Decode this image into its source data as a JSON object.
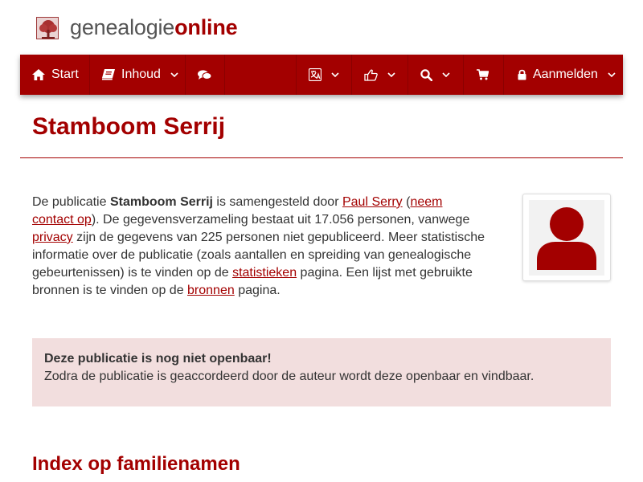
{
  "brand": {
    "name_plain": "genealogie",
    "name_accent": "online"
  },
  "nav": {
    "start": "Start",
    "inhoud": "Inhoud",
    "aanmelden": "Aanmelden"
  },
  "page": {
    "title": "Stamboom Serrij"
  },
  "intro": {
    "t1": "De publicatie ",
    "pub_name": "Stamboom Serrij",
    "t2": " is samengesteld door ",
    "author_link": "Paul Serry",
    "t3": " (",
    "contact_link": "neem contact op",
    "t4": "). De gegevensverzameling bestaat uit 17.056 personen, vanwege ",
    "privacy_link": "privacy",
    "t5": " zijn de gegevens van 225 personen niet gepubliceerd. Meer statistische informatie over de publicatie (zoals aantallen en spreiding van genealogische gebeurtenissen) is te vinden op de ",
    "stats_link": "statistieken",
    "t6": " pagina. Een lijst met gebruikte bronnen is te vinden op de ",
    "sources_link": "bronnen",
    "t7": " pagina."
  },
  "alert": {
    "title": "Deze publicatie is nog niet openbaar!",
    "text": "Zodra de publicatie is geaccordeerd door de auteur wordt deze openbaar en vindbaar."
  },
  "index": {
    "title": "Index op familienamen"
  },
  "icons": [
    "tree-logo-icon",
    "home-icon",
    "book-icon",
    "comments-icon",
    "language-icon",
    "thumbs-up-icon",
    "search-icon",
    "cart-icon",
    "lock-icon",
    "chevron-down-icon",
    "user-avatar-icon"
  ],
  "colors": {
    "brand": "#a30000",
    "alert_bg": "#f2dede"
  }
}
